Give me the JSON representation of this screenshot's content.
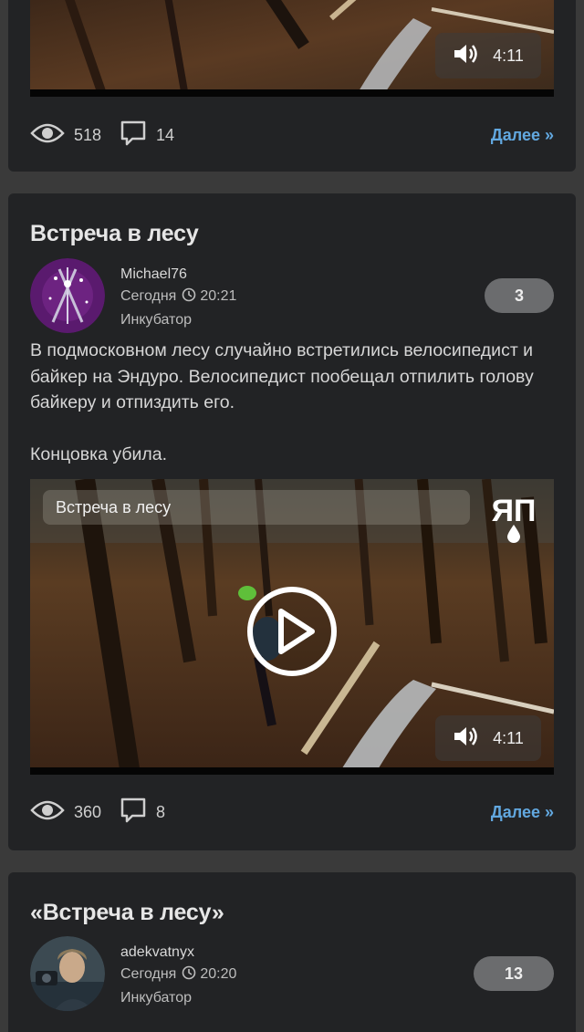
{
  "posts": [
    {
      "video": {
        "duration": "4:11"
      },
      "stats": {
        "views": "518",
        "comments": "14"
      },
      "more_label": "Далее »"
    },
    {
      "title": "Встреча в лесу",
      "author": {
        "name": "Michael76",
        "date": "Сегодня",
        "time": "20:21",
        "community": "Инкубатор"
      },
      "rating": "3",
      "body": [
        "В подмосковном лесу случайно встретились велосипедист и байкер на Эндуро. Велосипедист пообещал отпилить голову байкеру и отпиздить его.",
        "Концовка убила."
      ],
      "video": {
        "title": "Встреча в лесу",
        "duration": "4:11",
        "logo": "ЯП"
      },
      "stats": {
        "views": "360",
        "comments": "8"
      },
      "more_label": "Далее »"
    },
    {
      "title": "«Встреча в лесу»",
      "author": {
        "name": "adekvatnyx",
        "date": "Сегодня",
        "time": "20:20",
        "community": "Инкубатор"
      },
      "rating": "13"
    }
  ],
  "colors": {
    "card_bg": "#222325",
    "page_bg": "#3a3a3a",
    "link": "#62a8e0",
    "rating_bg": "#6b6c6e"
  }
}
